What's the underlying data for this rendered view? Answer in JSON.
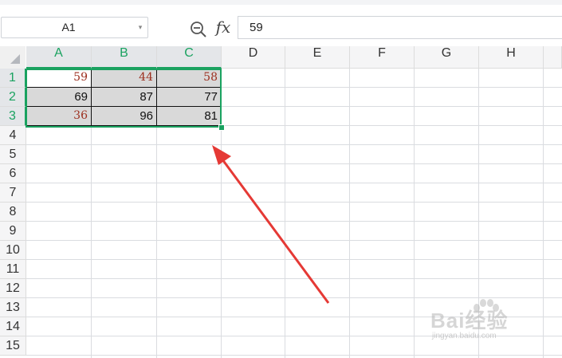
{
  "formula_bar": {
    "name_box": "A1",
    "dropdown_glyph": "▾",
    "zoom_icon": "zoom-icon",
    "fx_label": "fx",
    "formula_value": "59"
  },
  "columns": [
    "A",
    "B",
    "C",
    "D",
    "E",
    "F",
    "G",
    "H"
  ],
  "rows": [
    "1",
    "2",
    "3",
    "4",
    "5",
    "6",
    "7",
    "8",
    "9",
    "10",
    "11",
    "12",
    "13",
    "14",
    "15"
  ],
  "cells": {
    "r1": [
      "59",
      "44",
      "58"
    ],
    "r2": [
      "69",
      "87",
      "77"
    ],
    "r3": [
      "36",
      "96",
      "81"
    ]
  },
  "selection": {
    "range": "A1:C3",
    "active_cell": "A1"
  },
  "colors": {
    "accent": "#1aa260",
    "arrow": "#e53935",
    "red_text": "#9c2f1e"
  },
  "watermark": {
    "brand": "Bai经验",
    "url": "jingyan.baidu.com"
  }
}
